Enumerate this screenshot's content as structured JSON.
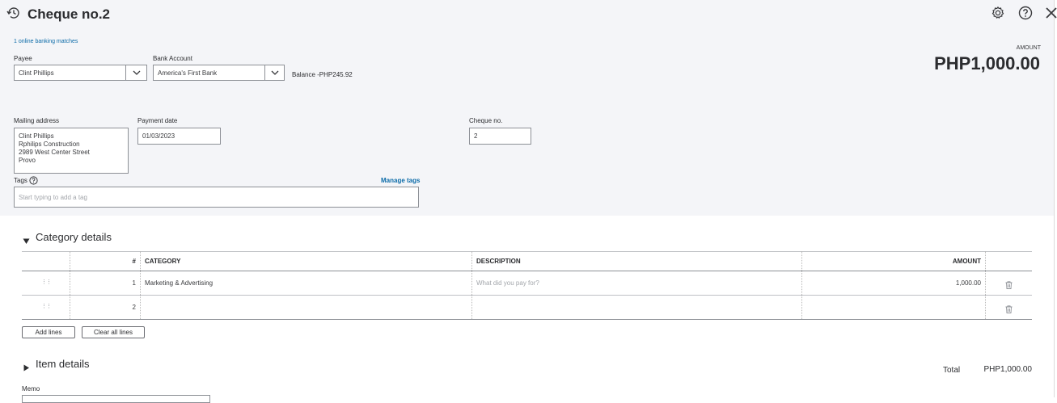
{
  "header": {
    "title": "Cheque no.2",
    "icons": {
      "history": "history-icon",
      "settings": "gear-icon",
      "help": "help-icon",
      "close": "close-icon"
    }
  },
  "banking_matches_link": "1 online banking matches",
  "payee": {
    "label": "Payee",
    "value": "Clint Phillips"
  },
  "bank_account": {
    "label": "Bank Account",
    "value": "America's First Bank"
  },
  "balance_text": "Balance -PHP245.92",
  "amount": {
    "label": "AMOUNT",
    "value": "PHP1,000.00"
  },
  "mailing_address": {
    "label": "Mailing address",
    "lines": [
      "Clint Phillips",
      "Rphilips Construction",
      "2989 West Center Street",
      "Provo"
    ]
  },
  "payment_date": {
    "label": "Payment date",
    "value": "01/03/2023"
  },
  "cheque_no": {
    "label": "Cheque no.",
    "value": "2"
  },
  "tags": {
    "label": "Tags",
    "manage_link": "Manage tags",
    "placeholder": "Start typing to add a tag"
  },
  "category_details": {
    "title": "Category details",
    "columns": {
      "num": "#",
      "category": "CATEGORY",
      "description": "DESCRIPTION",
      "amount": "AMOUNT"
    },
    "rows": [
      {
        "num": "1",
        "category": "Marketing & Advertising",
        "description_placeholder": "What did you pay for?",
        "amount": "1,000.00"
      },
      {
        "num": "2",
        "category": "",
        "description_placeholder": "",
        "amount": ""
      }
    ],
    "add_lines": "Add lines",
    "clear_all_lines": "Clear all lines"
  },
  "item_details": {
    "title": "Item details"
  },
  "total": {
    "label": "Total",
    "value": "PHP1,000.00"
  },
  "memo": {
    "label": "Memo"
  },
  "colors": {
    "panel_bg": "#f4f5f8",
    "link": "#0b6ba8",
    "text": "#393a3d"
  }
}
